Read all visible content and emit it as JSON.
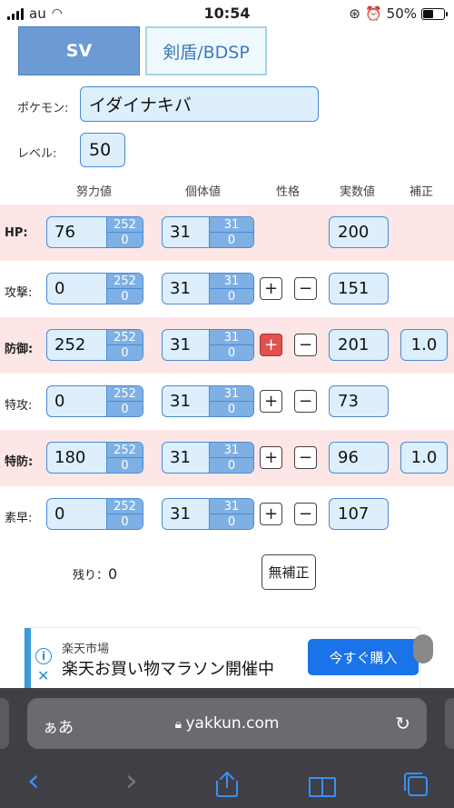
{
  "status": {
    "carrier": "au",
    "time": "10:54",
    "battery": "50%",
    "battery_level": 0.5
  },
  "tabs": {
    "sv": "SV",
    "bdsp": "剣盾/BDSP"
  },
  "pokemon": {
    "label": "ポケモン:",
    "value": "イダイナキバ"
  },
  "level": {
    "label": "レベル:",
    "value": "50"
  },
  "headers": {
    "ev": "努力値",
    "iv": "個体値",
    "nature": "性格",
    "actual": "実数値",
    "mult": "補正"
  },
  "rows": [
    {
      "name": "HP:",
      "ev": "76",
      "ev_max": "252",
      "ev_min": "0",
      "iv": "31",
      "iv_max": "31",
      "iv_min": "0",
      "plus": "",
      "minus": "",
      "actual": "200",
      "mult": ""
    },
    {
      "name": "攻撃:",
      "ev": "0",
      "ev_max": "252",
      "ev_min": "0",
      "iv": "31",
      "iv_max": "31",
      "iv_min": "0",
      "plus": "+",
      "minus": "−",
      "actual": "151",
      "mult": ""
    },
    {
      "name": "防御:",
      "ev": "252",
      "ev_max": "252",
      "ev_min": "0",
      "iv": "31",
      "iv_max": "31",
      "iv_min": "0",
      "plus": "+",
      "minus": "−",
      "actual": "201",
      "mult": "1.0"
    },
    {
      "name": "特攻:",
      "ev": "0",
      "ev_max": "252",
      "ev_min": "0",
      "iv": "31",
      "iv_max": "31",
      "iv_min": "0",
      "plus": "+",
      "minus": "−",
      "actual": "73",
      "mult": ""
    },
    {
      "name": "特防:",
      "ev": "180",
      "ev_max": "252",
      "ev_min": "0",
      "iv": "31",
      "iv_max": "31",
      "iv_min": "0",
      "plus": "+",
      "minus": "−",
      "actual": "96",
      "mult": "1.0"
    },
    {
      "name": "素早:",
      "ev": "0",
      "ev_max": "252",
      "ev_min": "0",
      "iv": "31",
      "iv_max": "31",
      "iv_min": "0",
      "plus": "+",
      "minus": "−",
      "actual": "107",
      "mult": ""
    }
  ],
  "remaining": {
    "label": "残り：",
    "value": "0"
  },
  "no_adjust": "無補正",
  "ad": {
    "small": "楽天市場",
    "big": "楽天お買い物マラソン開催中",
    "button": "今すぐ購入",
    "info": "i",
    "close": "✕"
  },
  "browser": {
    "aa": "ぁあ",
    "url": "yakkun.com",
    "back": "‹",
    "forward": "›"
  }
}
